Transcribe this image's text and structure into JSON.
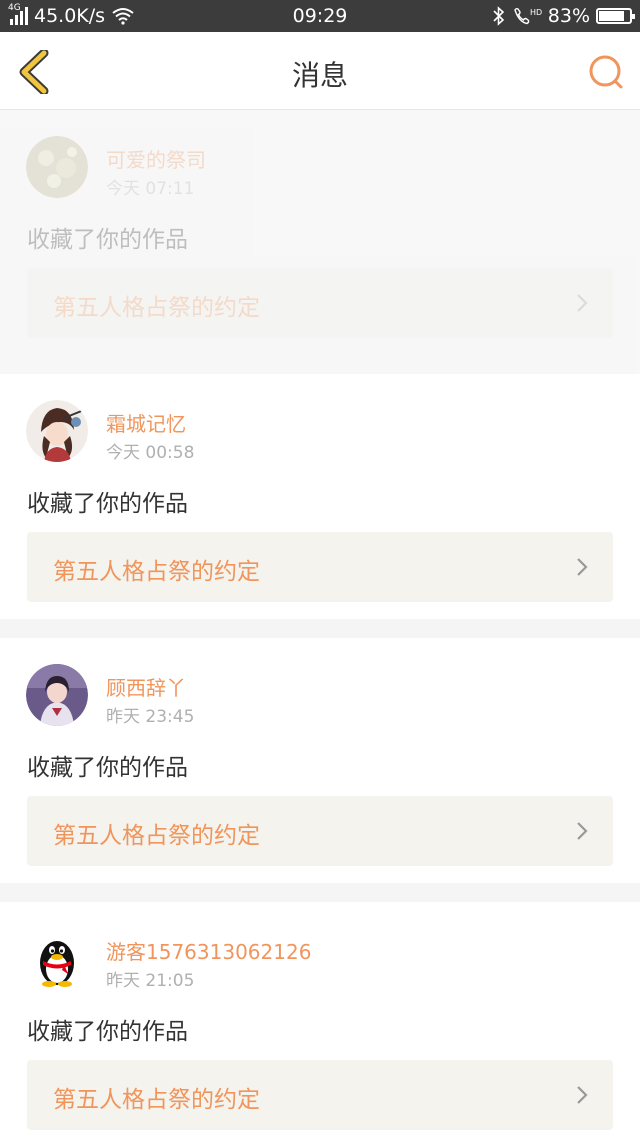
{
  "status": {
    "network": "4G",
    "speed": "45.0K/s",
    "time": "09:29",
    "battery": "83%",
    "battery_level": 0.83
  },
  "header": {
    "title": "消息",
    "back_icon": "chevron-left-icon",
    "search_icon": "search-icon"
  },
  "colors": {
    "accent": "#f0955c",
    "back_icon": "#f1c53c",
    "time": "#b0b0b0"
  },
  "messages": [
    {
      "user": "可爱的祭司",
      "time": "今天 07:11",
      "action": "收藏了你的作品",
      "work": "第五人格占祭的约定"
    },
    {
      "user": "霜城记忆",
      "time": "今天 00:58",
      "action": "收藏了你的作品",
      "work": "第五人格占祭的约定"
    },
    {
      "user": "顾西辞丫",
      "time": "昨天 23:45",
      "action": "收藏了你的作品",
      "work": "第五人格占祭的约定"
    },
    {
      "user": "游客1576313062126",
      "time": "昨天 21:05",
      "action": "收藏了你的作品",
      "work": "第五人格占祭的约定"
    }
  ]
}
